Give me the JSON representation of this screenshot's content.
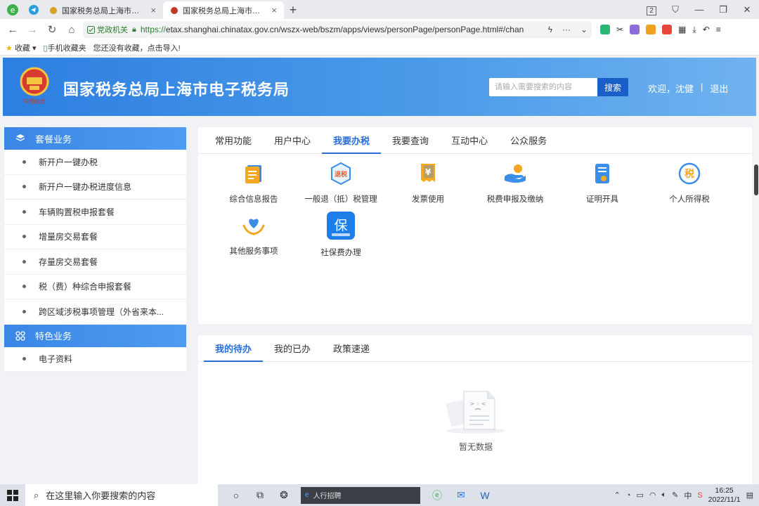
{
  "browser": {
    "tabs": [
      {
        "label": "国家税务总局上海市税务局",
        "active": false
      },
      {
        "label": "国家税务总局上海市电子税务局",
        "active": true
      }
    ],
    "tab_count": "2",
    "gov_badge": "党政机关",
    "url_scheme": "https://",
    "url_rest": "etax.shanghai.chinatax.gov.cn/wszx-web/bszm/apps/views/personPage/personPage.html#/chan"
  },
  "bookmarks": {
    "favorites": "收藏",
    "mobile": "手机收藏夹",
    "hint": "您还没有收藏，点击导入!"
  },
  "header": {
    "title": "国家税务总局上海市电子税务局",
    "search_placeholder": "请输入需要搜索的内容",
    "search_button": "搜索",
    "welcome": "欢迎，沈健",
    "separator": "|",
    "logout": "退出"
  },
  "sidebar": {
    "section1": "套餐业务",
    "items1": [
      "新开户一键办税",
      "新开户一键办税进度信息",
      "车辆购置税申报套餐",
      "增量房交易套餐",
      "存量房交易套餐",
      "税（费）种综合申报套餐",
      "跨区域涉税事项管理（外省来本..."
    ],
    "section2": "特色业务",
    "items2": [
      "电子资料"
    ]
  },
  "main": {
    "tabs": [
      "常用功能",
      "用户中心",
      "我要办税",
      "我要查询",
      "互动中心",
      "公众服务"
    ],
    "active_tab": "我要办税",
    "functions": [
      {
        "label": "综合信息报告",
        "icon": "report-icon"
      },
      {
        "label": "一般退（抵）税管理",
        "icon": "tax-refund-icon",
        "icon_text": "退税"
      },
      {
        "label": "发票使用",
        "icon": "invoice-icon",
        "icon_text": "¥"
      },
      {
        "label": "税费申报及缴纳",
        "icon": "payment-icon"
      },
      {
        "label": "证明开具",
        "icon": "certificate-icon"
      },
      {
        "label": "个人所得税",
        "icon": "income-tax-icon",
        "icon_text": "税"
      },
      {
        "label": "其他服务事项",
        "icon": "heart-hands-icon"
      },
      {
        "label": "社保费办理",
        "icon": "social-security-icon",
        "icon_text": "保"
      }
    ]
  },
  "bottom": {
    "tabs": [
      "我的待办",
      "我的已办",
      "政策速递"
    ],
    "active_tab": "我的待办",
    "empty_text": "暂无数据"
  },
  "taskbar": {
    "search_placeholder": "在这里输入你要搜索的内容",
    "ie_text": "人行招聘",
    "time": "16:25",
    "date": "2022/11/1"
  },
  "colors": {
    "primary": "#2a6fd8",
    "header_start": "#2d7fe0",
    "header_end": "#6fb2ef",
    "search_button": "#1a5fc8"
  }
}
